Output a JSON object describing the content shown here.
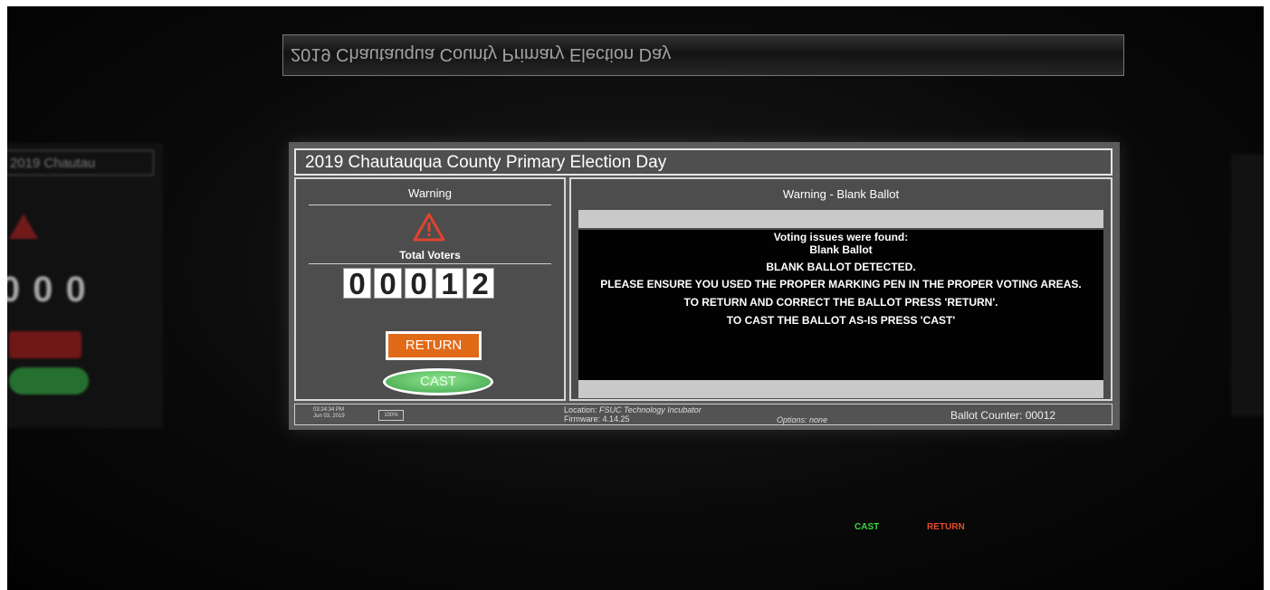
{
  "reflection": {
    "text": "2019 Chautauqua County Primary Election Day"
  },
  "side_left": {
    "title": "2019 Chautau",
    "digits": "000"
  },
  "screen": {
    "title": "2019 Chautauqua County Primary Election Day",
    "left_panel": {
      "heading": "Warning",
      "voters_label": "Total Voters",
      "digits": [
        "0",
        "0",
        "0",
        "1",
        "2"
      ],
      "return_label": "RETURN",
      "cast_label": "CAST",
      "icon": "warning-triangle-icon"
    },
    "right_panel": {
      "heading": "Warning - Blank Ballot",
      "lines": [
        "Voting issues were found:",
        "Blank Ballot",
        "BLANK BALLOT DETECTED.",
        "PLEASE ENSURE YOU USED THE PROPER MARKING PEN IN THE PROPER VOTING AREAS.",
        "TO RETURN AND CORRECT THE BALLOT PRESS 'RETURN'.",
        "TO CAST THE BALLOT AS-IS PRESS 'CAST'"
      ]
    },
    "status_bar": {
      "time": "03:24:34 PM",
      "date": "Jun 03, 2019",
      "battery": "100%",
      "location_label": "Location:",
      "location": "FSUC Technology Incubator",
      "firmware_label": "Firmware:",
      "firmware": "4.14.25",
      "options_label": "Options:",
      "options": "none",
      "ballot_counter": "Ballot Counter: 00012"
    }
  },
  "hardware": {
    "cast_led": "CAST",
    "return_led": "RETURN"
  },
  "colors": {
    "return_button": "#e16a17",
    "cast_button": "#3ea24a",
    "warning_icon": "#d63a2a",
    "cast_led": "#3dd63d",
    "return_led": "#e24a2a"
  }
}
